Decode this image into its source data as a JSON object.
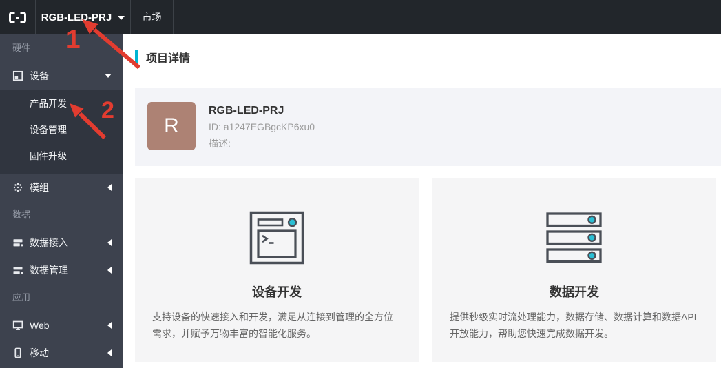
{
  "topbar": {
    "project_selector": "RGB-LED-PRJ",
    "market_tab": "市场"
  },
  "sidebar": {
    "section_hardware": "硬件",
    "device": "设备",
    "device_submenu": [
      "产品开发",
      "设备管理",
      "固件升级"
    ],
    "module": "模组",
    "section_data": "数据",
    "data_access": "数据接入",
    "data_manage": "数据管理",
    "section_app": "应用",
    "web": "Web",
    "mobile": "移动"
  },
  "main": {
    "page_title": "项目详情",
    "project": {
      "avatar_letter": "R",
      "name": "RGB-LED-PRJ",
      "id_line": "ID: a1247EGBgcKP6xu0",
      "desc_line": "描述:"
    },
    "cards": [
      {
        "title": "设备开发",
        "description": "支持设备的快速接入和开发，满足从连接到管理的全方位需求，并赋予万物丰富的智能化服务。"
      },
      {
        "title": "数据开发",
        "description": "提供秒级实时流处理能力，数据存储、数据计算和数据API开放能力，帮助您快速完成数据开发。"
      }
    ]
  },
  "annotations": {
    "step1": "1",
    "step2": "2"
  },
  "icons": {
    "logo": "brackets-logo-icon",
    "device": "window-icon",
    "module": "dotted-sphere-icon",
    "data": "database-icon",
    "web": "monitor-icon",
    "mobile": "smartphone-icon",
    "device_dev": "terminal-window-icon",
    "data_dev": "server-stack-icon"
  },
  "colors": {
    "topbar_bg": "#22262b",
    "sidebar_bg": "#3d424e",
    "submenu_bg": "#30353f",
    "accent_cyan": "#00b4d2",
    "icon_dot_cyan": "#2bbfd4",
    "icon_stroke": "#4a4f57",
    "avatar_bg": "#ad8274",
    "annotation_red": "#e23c30",
    "project_card_bg": "#f3f4f8",
    "feature_card_bg": "#f5f5f6"
  }
}
